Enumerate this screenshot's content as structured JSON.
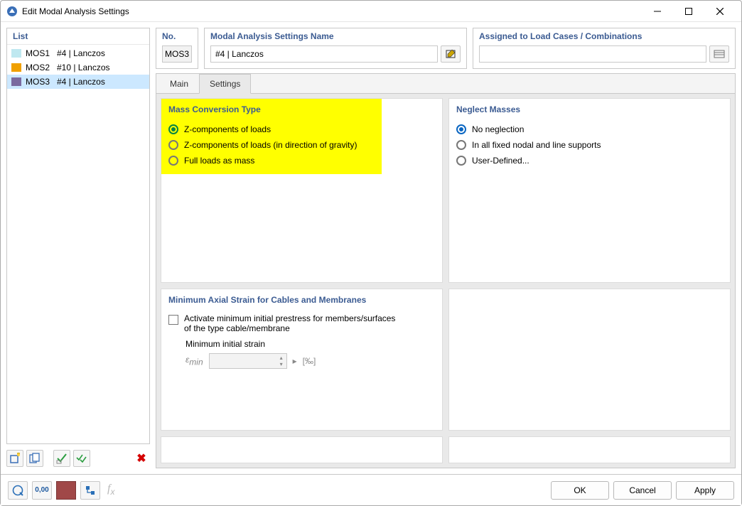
{
  "window": {
    "title": "Edit Modal Analysis Settings"
  },
  "left": {
    "header": "List",
    "items": [
      {
        "ident": "MOS1",
        "name": "#4 | Lanczos",
        "color": "#bfe8f0"
      },
      {
        "ident": "MOS2",
        "name": "#10 | Lanczos",
        "color": "#f0a000"
      },
      {
        "ident": "MOS3",
        "name": "#4 | Lanczos",
        "color": "#7a6aa0"
      }
    ],
    "selected_index": 2
  },
  "top": {
    "no_label": "No.",
    "no_value": "MOS3",
    "name_label": "Modal Analysis Settings Name",
    "name_value": "#4 | Lanczos",
    "assigned_label": "Assigned to Load Cases / Combinations",
    "assigned_value": ""
  },
  "tabs": {
    "items": [
      "Main",
      "Settings"
    ],
    "active_index": 1
  },
  "mass_conversion": {
    "title": "Mass Conversion Type",
    "options": [
      "Z-components of loads",
      "Z-components of loads (in direction of gravity)",
      "Full loads as mass"
    ],
    "selected_index": 0
  },
  "neglect": {
    "title": "Neglect Masses",
    "options": [
      "No neglection",
      "In all fixed nodal and line supports",
      "User-Defined..."
    ],
    "selected_index": 0
  },
  "min_strain": {
    "title": "Minimum Axial Strain for Cables and Membranes",
    "checkbox_label": "Activate minimum initial prestress for members/surfaces of the type cable/membrane",
    "checked": false,
    "field_label": "Minimum initial strain",
    "symbol": "εmin",
    "unit": "[‰]"
  },
  "footer": {
    "ok": "OK",
    "cancel": "Cancel",
    "apply": "Apply"
  }
}
